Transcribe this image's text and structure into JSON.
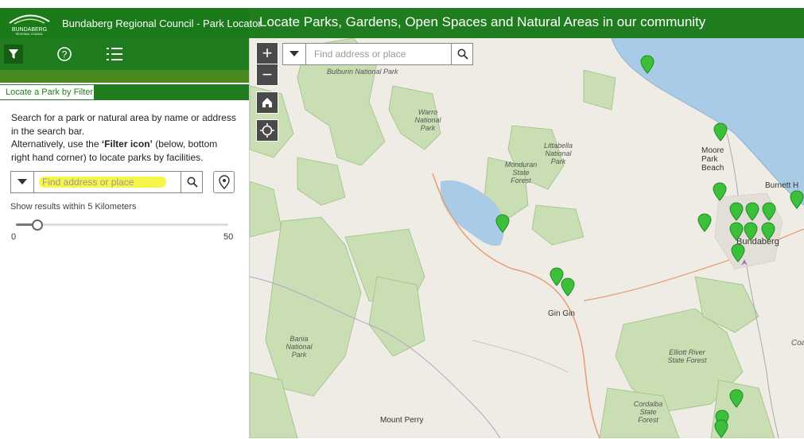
{
  "header": {
    "logo_text": "BUNDABERG",
    "logo_subtext": "REGIONAL COUNCIL",
    "app_title": "Bundaberg Regional Council  - Park Locator",
    "map_title": "Locate Parks, Gardens, Open Spaces and Natural Areas in our community"
  },
  "toolbar": {
    "icons": [
      "filter-icon",
      "help-icon",
      "list-icon"
    ]
  },
  "panel": {
    "tab_label": "Locate a Park by Filter",
    "desc_1": "Search for a park or natural area by name or address in the search bar.",
    "desc_2a": "Alternatively, use the ",
    "desc_2b": "‘Filter icon’",
    "desc_2c": " (below, bottom right hand corner) to locate parks by facilities.",
    "search_placeholder": "Find address or place",
    "radius_label": "Show results within 5 Kilometers",
    "slider": {
      "min": "0",
      "max": "50",
      "value": 5
    }
  },
  "map": {
    "search_placeholder": "Find address or place",
    "zoom_in": "+",
    "zoom_out": "−",
    "labels": {
      "bulburin": "Bulburin National Park",
      "warro": "Warro National Park",
      "littabella": "Littabella National Park",
      "monduran": "Monduran State Forest",
      "bania": "Bania National Park",
      "elliott": "Elliott River State Forest",
      "cordalba": "Cordalba State Forest"
    },
    "towns": {
      "moore_park": "Moore Park Beach",
      "burnett": "Burnett H",
      "bundaberg": "Bundaberg",
      "gin_gin": "Gin Gin",
      "mount_perry": "Mount Perry",
      "coral": "Coa"
    },
    "colors": {
      "forest": "#c9dfb3",
      "water": "#aacbe8",
      "pin": "#3cc03c",
      "road": "#e8a079"
    }
  }
}
